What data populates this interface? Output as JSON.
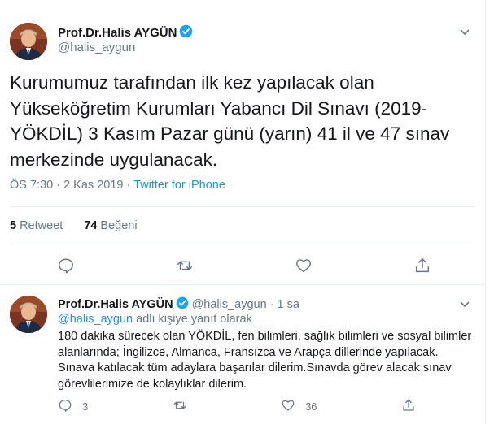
{
  "main_tweet": {
    "author_name": "Prof.Dr.Halis AYGÜN",
    "author_handle": "@halis_aygun",
    "text": "Kurumumuz tarafından ilk kez yapılacak olan Yükseköğretim Kurumları Yabancı Dil Sınavı (2019-YÖKDİL) 3 Kasım Pazar günü (yarın) 41 il ve 47 sınav merkezinde uygulanacak.",
    "time": "ÖS 7:30 · 2 Kas 2019 · ",
    "source": "Twitter for iPhone",
    "retweet_count": "5",
    "retweet_label": "Retweet",
    "like_count": "74",
    "like_label": "Beğeni",
    "icons": [
      "verified-badge-icon",
      "chevron-down-icon",
      "reply-icon",
      "retweet-icon",
      "like-icon",
      "share-icon"
    ]
  },
  "reply_tweet": {
    "author_name": "Prof.Dr.Halis AYGÜN",
    "author_handle": "@halis_aygun",
    "time": "· 1 sa",
    "reply_to_handle": "@halis_aygun",
    "reply_to_suffix": " adlı kişiye yanıt olarak",
    "text": "180 dakika sürecek olan YÖKDİL, fen bilimleri, sağlık bilimleri ve sosyal bilimler alanlarında; İngilizce, Almanca, Fransızca ve Arapça dillerinde yapılacak. Sınava katılacak tüm adaylara başarılar dilerim.Sınavda görev alacak sınav görevlilerimize de kolaylıklar dilerim.",
    "reply_count": "3",
    "retweet_count": "",
    "like_count": "36"
  },
  "colors": {
    "link": "#1b95e0",
    "muted": "#657786",
    "text": "#14171a",
    "divider": "#e6ecf0"
  }
}
